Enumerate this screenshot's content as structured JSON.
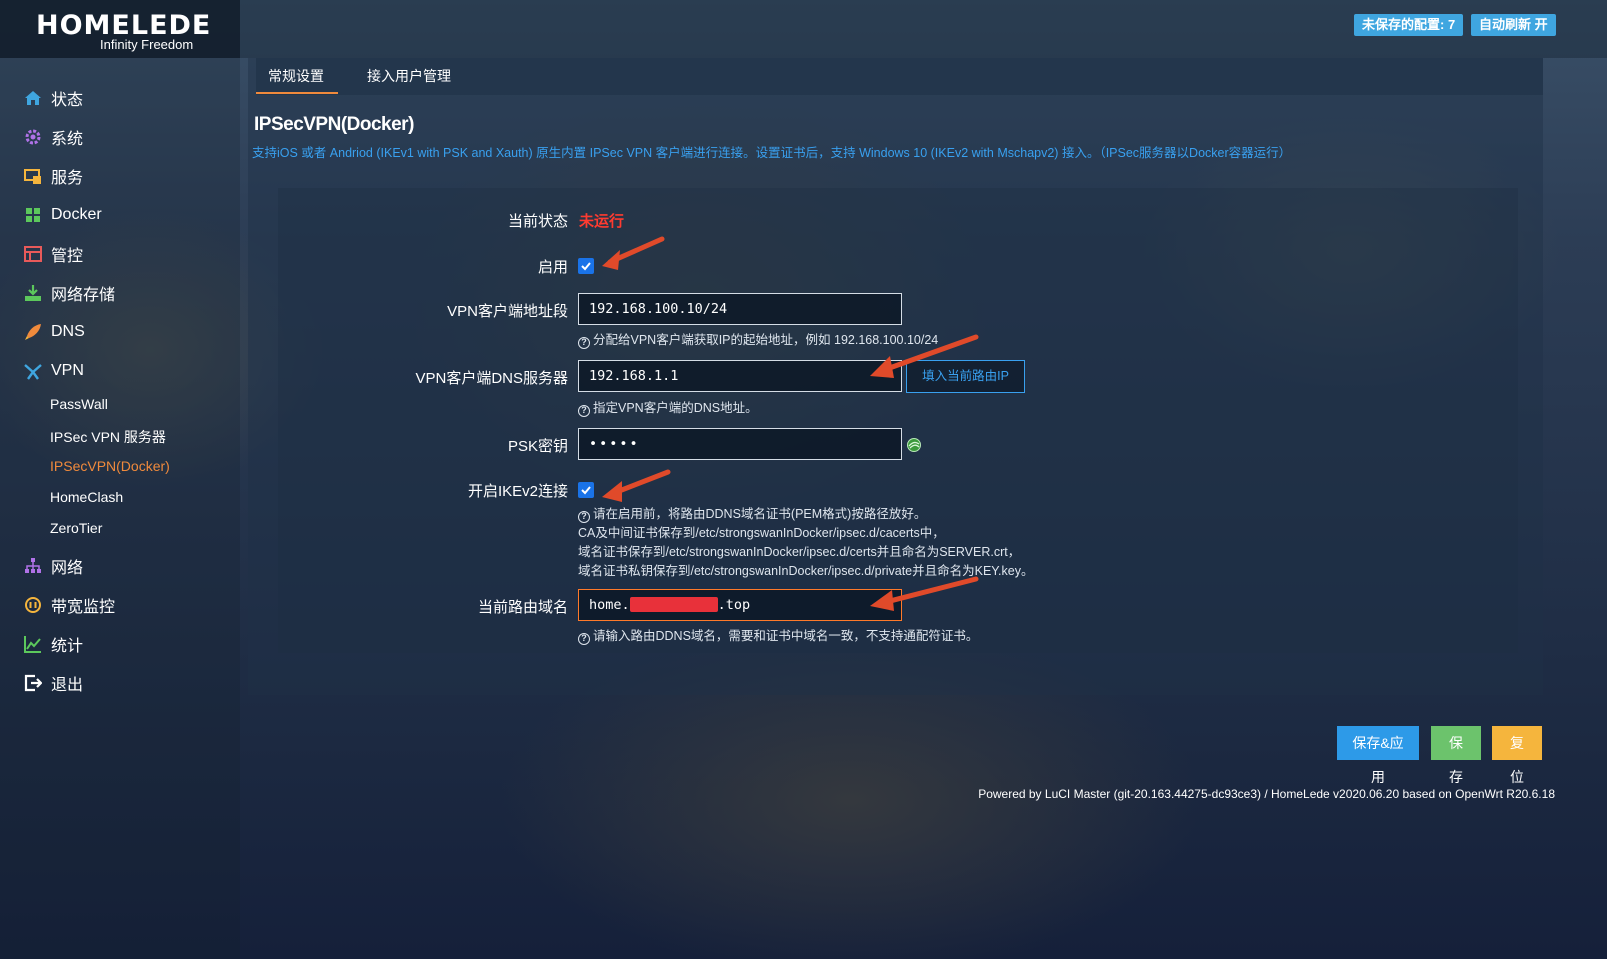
{
  "brand": {
    "logo_main": "HOMELEDE",
    "logo_sub": "Infinity Freedom"
  },
  "header": {
    "unsaved_label": "未保存的配置: 7",
    "auto_refresh_label": "自动刷新 开",
    "colors": {
      "badge": "#3fa6e0"
    }
  },
  "sidebar": {
    "items": [
      {
        "label": "状态",
        "icon": "home-icon"
      },
      {
        "label": "系统",
        "icon": "gear-icon"
      },
      {
        "label": "服务",
        "icon": "services-icon"
      },
      {
        "label": "Docker",
        "icon": "docker-icon"
      },
      {
        "label": "管控",
        "icon": "control-icon"
      },
      {
        "label": "网络存储",
        "icon": "storage-icon"
      },
      {
        "label": "DNS",
        "icon": "rocket-icon"
      },
      {
        "label": "VPN",
        "icon": "vpn-icon"
      },
      {
        "label": "网络",
        "icon": "network-icon"
      },
      {
        "label": "带宽监控",
        "icon": "bandwidth-icon"
      },
      {
        "label": "统计",
        "icon": "chart-icon"
      },
      {
        "label": "退出",
        "icon": "logout-icon"
      }
    ],
    "vpn_subitems": [
      {
        "label": "PassWall"
      },
      {
        "label": "IPSec VPN 服务器"
      },
      {
        "label": "IPSecVPN(Docker)",
        "active": true
      },
      {
        "label": "HomeClash"
      },
      {
        "label": "ZeroTier"
      }
    ]
  },
  "tabs": [
    {
      "label": "常规设置",
      "active": true
    },
    {
      "label": "接入用户管理"
    }
  ],
  "page": {
    "title": "IPSecVPN(Docker)",
    "description": "支持iOS 或者 Andriod (IKEv1 with PSK and Xauth) 原生内置 IPSec VPN 客户端进行连接。设置证书后，支持 Windows 10 (IKEv2 with Mschapv2) 接入。（IPSec服务器以Docker容器运行）"
  },
  "form": {
    "status_label": "当前状态",
    "status_value": "未运行",
    "enable_label": "启用",
    "client_subnet_label": "VPN客户端地址段",
    "client_subnet_value": "192.168.100.10/24",
    "client_subnet_hint": "分配给VPN客户端获取IP的起始地址，例如 192.168.100.10/24",
    "dns_label": "VPN客户端DNS服务器",
    "dns_value": "192.168.1.1",
    "dns_fill_button": "填入当前路由IP",
    "dns_hint": "指定VPN客户端的DNS地址。",
    "psk_label": "PSK密钥",
    "psk_value": "•••••",
    "ikev2_label": "开启IKEv2连接",
    "ikev2_hint_lines": [
      "请在启用前，将路由DDNS域名证书(PEM格式)按路径放好。",
      "CA及中间证书保存到/etc/strongswanInDocker/ipsec.d/cacerts中，",
      "域名证书保存到/etc/strongswanInDocker/ipsec.d/certs并且命名为SERVER.crt，",
      "域名证书私钥保存到/etc/strongswanInDocker/ipsec.d/private并且命名为KEY.key。"
    ],
    "domain_label": "当前路由域名",
    "domain_prefix": "home.",
    "domain_suffix": ".top",
    "domain_hint": "请输入路由DDNS域名，需要和证书中域名一致，不支持通配符证书。"
  },
  "actions": {
    "save_apply": "保存&应用",
    "save": "保存",
    "reset": "复位",
    "colors": {
      "save_apply": "#2d9ae8",
      "save": "#6cc36c",
      "reset": "#f5b53d"
    }
  },
  "footer": "Powered by LuCI Master (git-20.163.44275-dc93ce3) / HomeLede v2020.06.20 based on OpenWrt R20.6.18"
}
